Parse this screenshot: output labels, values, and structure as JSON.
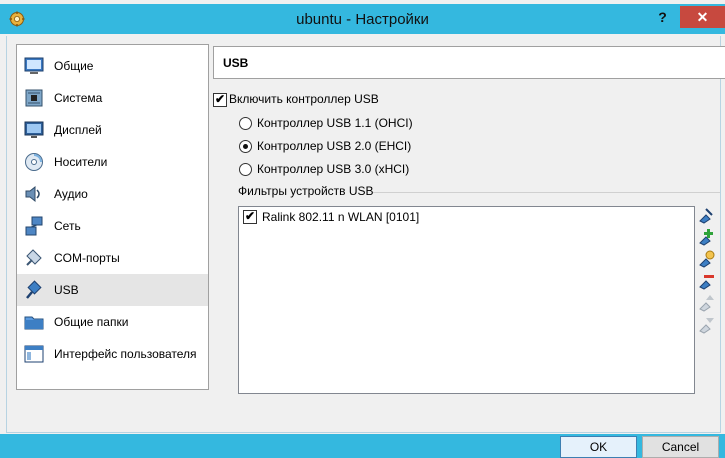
{
  "window": {
    "title": "ubuntu - Настройки",
    "help": "?",
    "close": "✕"
  },
  "sidebar": {
    "items": [
      {
        "label": "Общие",
        "icon": "general-icon"
      },
      {
        "label": "Система",
        "icon": "motherboard-icon"
      },
      {
        "label": "Дисплей",
        "icon": "display-icon"
      },
      {
        "label": "Носители",
        "icon": "storage-icon"
      },
      {
        "label": "Аудио",
        "icon": "audio-icon"
      },
      {
        "label": "Сеть",
        "icon": "network-icon"
      },
      {
        "label": "COM-порты",
        "icon": "serial-port-icon"
      },
      {
        "label": "USB",
        "icon": "usb-icon",
        "selected": true
      },
      {
        "label": "Общие папки",
        "icon": "shared-folder-icon"
      },
      {
        "label": "Интерфейс пользователя",
        "icon": "user-interface-icon"
      }
    ]
  },
  "page": {
    "header": "USB",
    "enable_usb": {
      "label": "Включить контроллер USB",
      "checked": true
    },
    "controllers": [
      {
        "label": "Контроллер USB 1.1 (OHCI)",
        "selected": false
      },
      {
        "label": "Контроллер USB 2.0 (EHCI)",
        "selected": true
      },
      {
        "label": "Контроллер USB 3.0 (xHCI)",
        "selected": false
      }
    ],
    "filters_title": "Фильтры устройств USB",
    "filters": [
      {
        "label": "Ralink 802.11 n WLAN [0101]",
        "checked": true
      }
    ],
    "tools": [
      "add-empty-filter-icon",
      "add-device-filter-icon",
      "edit-filter-icon",
      "remove-filter-icon",
      "move-filter-up-icon",
      "move-filter-down-icon"
    ]
  },
  "buttons": {
    "ok": "OK",
    "cancel": "Cancel"
  },
  "colors": {
    "titlebar": "#34b8df",
    "close": "#c7493f",
    "selected_item": "#e5e5e5"
  }
}
